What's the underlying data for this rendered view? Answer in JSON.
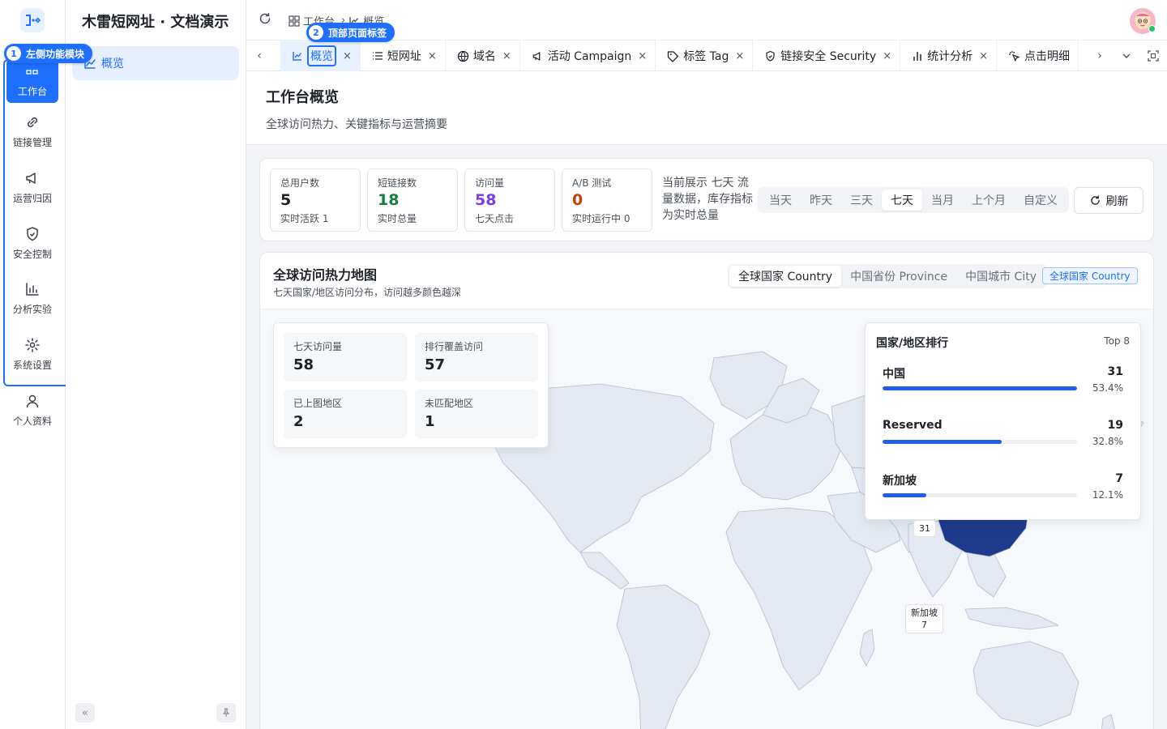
{
  "app": {
    "name": "木雷短网址 · 文档演示"
  },
  "colors": {
    "primary": "#1f6fff",
    "map_dark": "#1e3a8a",
    "success": "#15803d",
    "purple": "#7c3aed",
    "danger": "#c2410c"
  },
  "callouts": [
    {
      "num": "1",
      "text": "左侧功能模块"
    },
    {
      "num": "2",
      "text": "顶部页面标签"
    }
  ],
  "rail": {
    "items": [
      {
        "label": "工作台",
        "icon": "dashboard-icon",
        "active": true
      },
      {
        "label": "链接管理",
        "icon": "link-icon"
      },
      {
        "label": "运营归因",
        "icon": "megaphone-icon"
      },
      {
        "label": "安全控制",
        "icon": "shield-icon"
      },
      {
        "label": "分析实验",
        "icon": "bar-chart-icon"
      },
      {
        "label": "系统设置",
        "icon": "gear-icon"
      },
      {
        "label": "个人资料",
        "icon": "user-icon"
      }
    ]
  },
  "sidebar": {
    "items": [
      {
        "label": "概览",
        "icon": "chart-line-icon"
      }
    ]
  },
  "breadcrumb": {
    "items": [
      "工作台",
      "概览"
    ]
  },
  "tabs": [
    {
      "label": "概览",
      "icon": "chart-line-icon",
      "active": true
    },
    {
      "label": "短网址",
      "icon": "list-icon"
    },
    {
      "label": "域名",
      "icon": "globe-icon"
    },
    {
      "label": "活动 Campaign",
      "icon": "megaphone-icon"
    },
    {
      "label": "标签 Tag",
      "icon": "tag-icon"
    },
    {
      "label": "链接安全 Security",
      "icon": "shield-icon"
    },
    {
      "label": "统计分析",
      "icon": "bar-chart-icon"
    },
    {
      "label": "点击明细",
      "icon": "click-icon"
    }
  ],
  "page": {
    "title": "工作台概览",
    "subtitle": "全球访问热力、关键指标与运营摘要"
  },
  "stats": [
    {
      "label": "总用户数",
      "value": "5",
      "note": "实时活跃 1",
      "color": "#1f2329"
    },
    {
      "label": "短链接数",
      "value": "18",
      "note": "实时总量",
      "color": "#15803d"
    },
    {
      "label": "访问量",
      "value": "58",
      "note": "七天点击",
      "color": "#7c3aed"
    },
    {
      "label": "A/B 测试",
      "value": "0",
      "note": "实时运行中 0",
      "color": "#c2410c"
    }
  ],
  "stats_desc": "当前展示 七天 流量数据，库存指标为实时总量",
  "range": {
    "options": [
      "当天",
      "昨天",
      "三天",
      "七天",
      "当月",
      "上个月",
      "自定义"
    ],
    "selected": "七天"
  },
  "refresh_label": "刷新",
  "map": {
    "title": "全球访问热力地图",
    "subtitle": "七天国家/地区访问分布，访问越多颜色越深",
    "scopes": [
      "全球国家 Country",
      "中国省份 Province",
      "中国城市 City"
    ],
    "selected_scope": "全球国家 Country",
    "badge": "全球国家 Country",
    "summary": [
      {
        "label": "七天访问量",
        "value": "58"
      },
      {
        "label": "排行覆盖访问",
        "value": "57"
      },
      {
        "label": "已上图地区",
        "value": "2"
      },
      {
        "label": "未匹配地区",
        "value": "1"
      }
    ],
    "ranking": {
      "title": "国家/地区排行",
      "top": "Top 8",
      "rows": [
        {
          "name": "中国",
          "count": "31",
          "pct": "53.4%",
          "share": 0.534
        },
        {
          "name": "Reserved",
          "count": "19",
          "pct": "32.8%",
          "share": 0.328
        },
        {
          "name": "新加坡",
          "count": "7",
          "pct": "12.1%",
          "share": 0.121
        }
      ]
    },
    "markers": [
      {
        "name": "",
        "value": "31"
      },
      {
        "name": "新加坡",
        "value": "7"
      }
    ]
  }
}
